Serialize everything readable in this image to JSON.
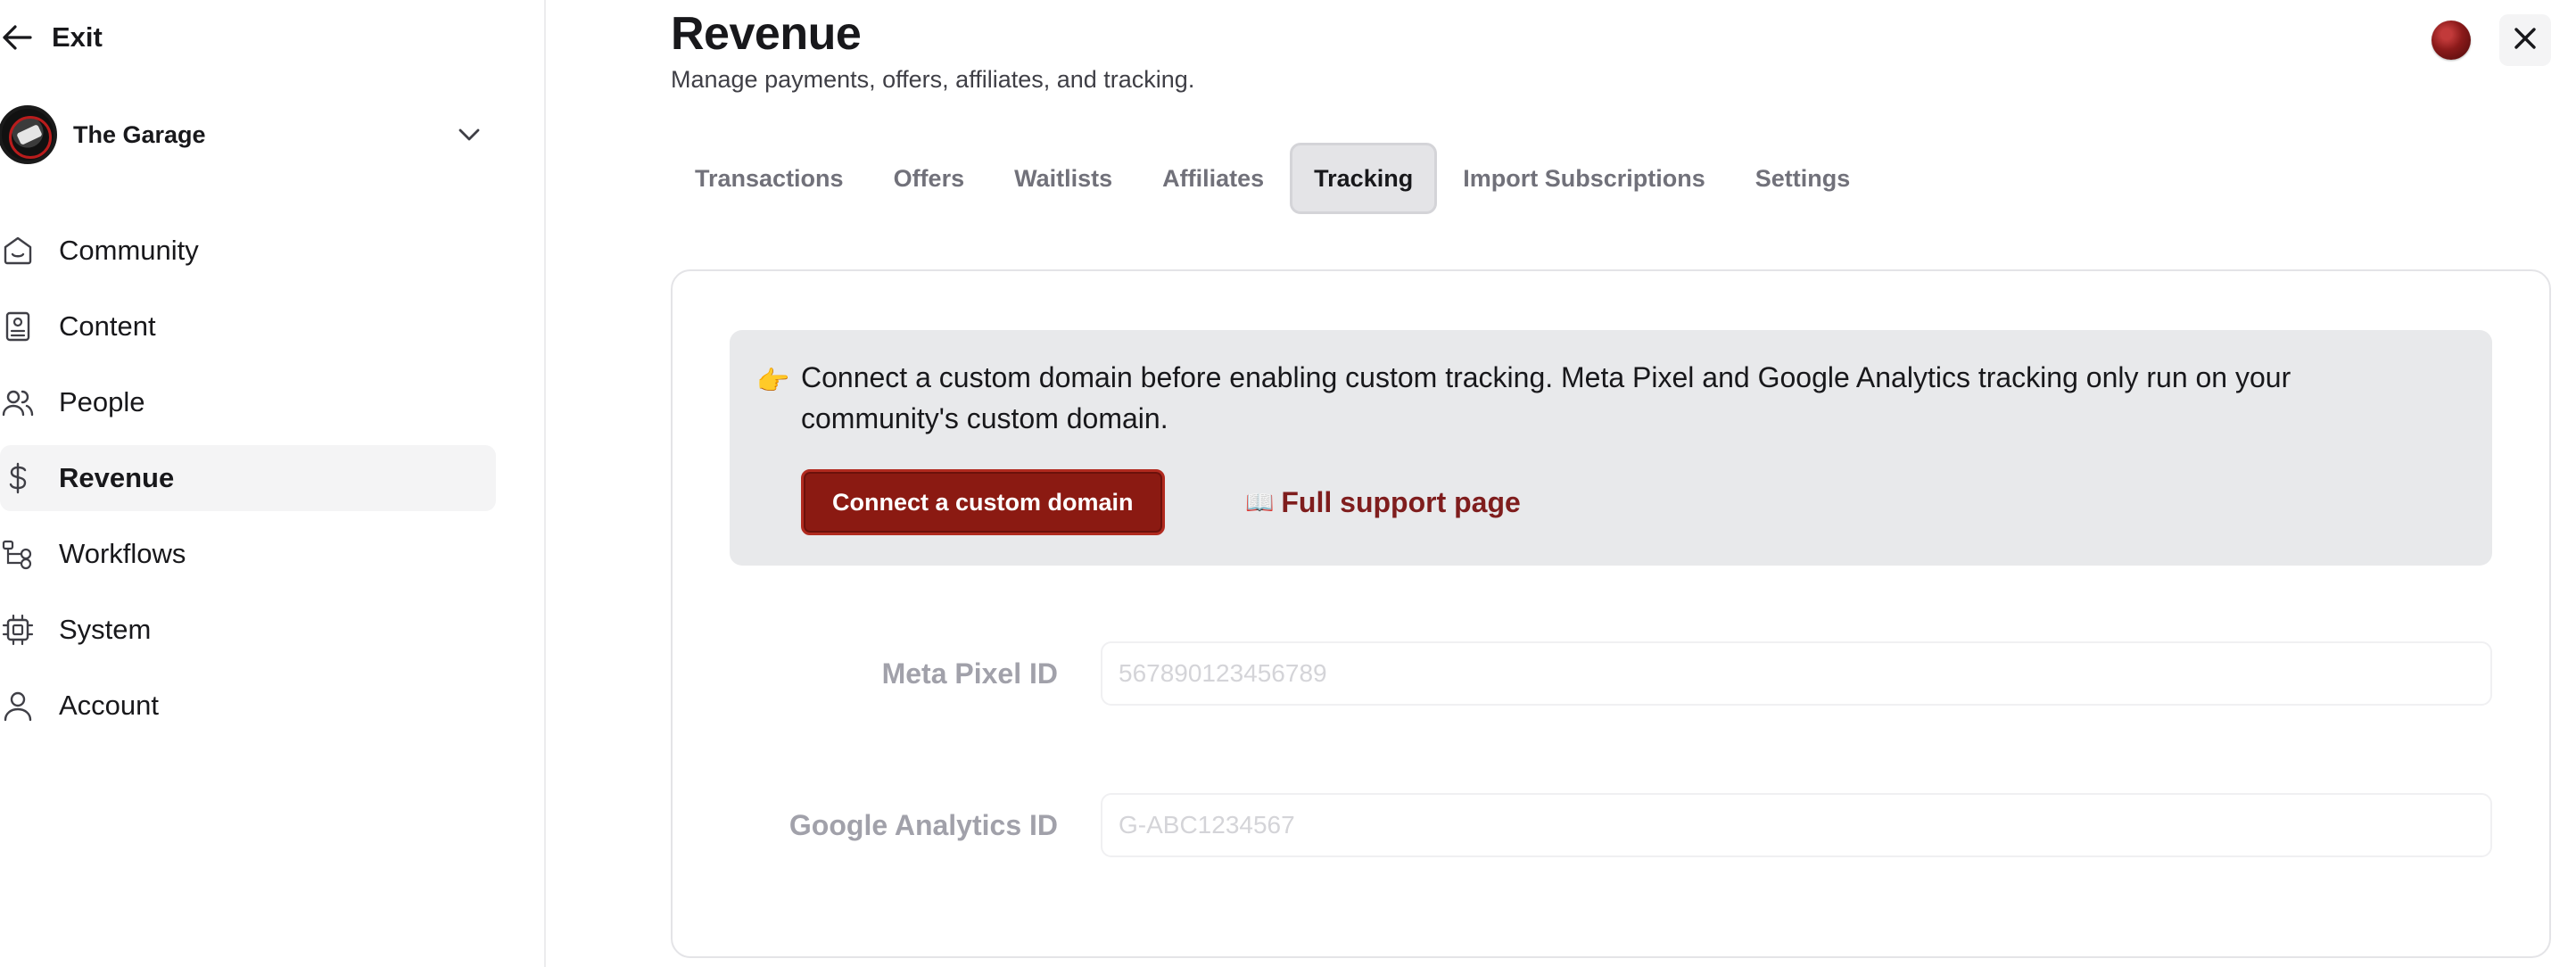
{
  "sidebar": {
    "exit_label": "Exit",
    "community_name": "The Garage",
    "items": [
      {
        "label": "Community",
        "icon": "home-icon"
      },
      {
        "label": "Content",
        "icon": "content-icon"
      },
      {
        "label": "People",
        "icon": "people-icon"
      },
      {
        "label": "Revenue",
        "icon": "dollar-icon",
        "active": true
      },
      {
        "label": "Workflows",
        "icon": "workflow-icon"
      },
      {
        "label": "System",
        "icon": "chip-icon"
      },
      {
        "label": "Account",
        "icon": "user-icon"
      }
    ]
  },
  "header": {
    "title": "Revenue",
    "subtitle": "Manage payments, offers, affiliates, and tracking."
  },
  "tabs": [
    {
      "label": "Transactions"
    },
    {
      "label": "Offers"
    },
    {
      "label": "Waitlists"
    },
    {
      "label": "Affiliates"
    },
    {
      "label": "Tracking",
      "active": true
    },
    {
      "label": "Import Subscriptions"
    },
    {
      "label": "Settings"
    }
  ],
  "notice": {
    "emoji": "👉",
    "text": "Connect a custom domain before enabling custom tracking. Meta Pixel and Google Analytics tracking only run on your community's custom domain.",
    "button_label": "Connect a custom domain",
    "link_icon": "📖",
    "link_label": "Full support page"
  },
  "fields": {
    "meta_pixel": {
      "label": "Meta Pixel ID",
      "placeholder": "567890123456789",
      "value": ""
    },
    "google_analytics": {
      "label": "Google Analytics ID",
      "placeholder": "G-ABC1234567",
      "value": ""
    }
  },
  "colors": {
    "accent": "#8b1a12",
    "link": "#7f1d1d",
    "notice_bg": "#e8e9eb",
    "active_nav_bg": "#f4f4f5"
  }
}
